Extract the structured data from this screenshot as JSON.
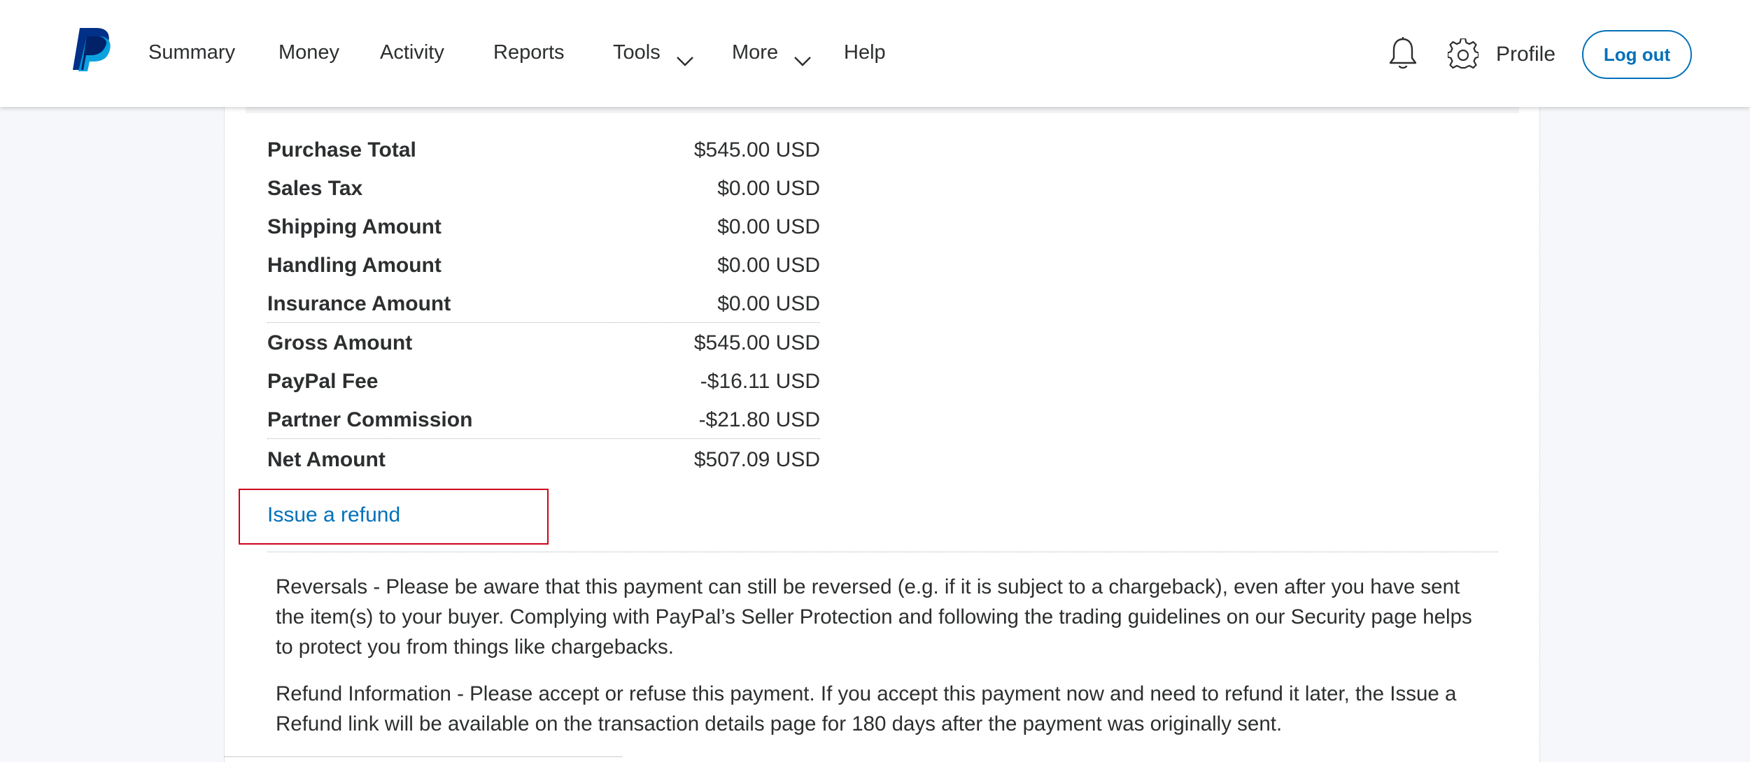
{
  "header": {
    "nav": [
      {
        "label": "Summary",
        "has_dropdown": false
      },
      {
        "label": "Money",
        "has_dropdown": false
      },
      {
        "label": "Activity",
        "has_dropdown": false
      },
      {
        "label": "Reports",
        "has_dropdown": false
      },
      {
        "label": "Tools",
        "has_dropdown": true
      },
      {
        "label": "More",
        "has_dropdown": true
      },
      {
        "label": "Help",
        "has_dropdown": false
      }
    ],
    "icons": {
      "notifications": "bell-icon",
      "settings": "gear-icon"
    },
    "profile_label": "Profile",
    "logout_label": "Log out"
  },
  "summary": {
    "rows": [
      {
        "label": "Purchase Total",
        "value": "$545.00 USD"
      },
      {
        "label": "Sales Tax",
        "value": "$0.00 USD"
      },
      {
        "label": "Shipping Amount",
        "value": "$0.00 USD"
      },
      {
        "label": "Handling Amount",
        "value": "$0.00 USD"
      },
      {
        "label": "Insurance Amount",
        "value": "$0.00 USD"
      },
      {
        "label": "Gross Amount",
        "value": "$545.00 USD"
      },
      {
        "label": "PayPal Fee",
        "value": "-$16.11 USD"
      },
      {
        "label": "Partner Commission",
        "value": "-$21.80 USD"
      },
      {
        "label": "Net Amount",
        "value": "$507.09 USD"
      }
    ]
  },
  "refund": {
    "link_label": "Issue a refund"
  },
  "notices": {
    "reversals": "Reversals - Please be aware that this payment can still be reversed (e.g. if it is subject to a chargeback), even after you have sent the item(s) to your buyer. Complying with PayPal’s Seller Protection and following the trading guidelines on our Security page helps to protect you from things like chargebacks.",
    "refund_info": "Refund Information - Please accept or refuse this payment. If you accept this payment now and need to refund it later, the Issue a Refund link will be available on the transaction details page for 180 days after the payment was originally sent."
  },
  "colors": {
    "brand_dark": "#003087",
    "brand_light": "#009cde",
    "link": "#0070ba",
    "highlight_box": "#d0021b"
  }
}
